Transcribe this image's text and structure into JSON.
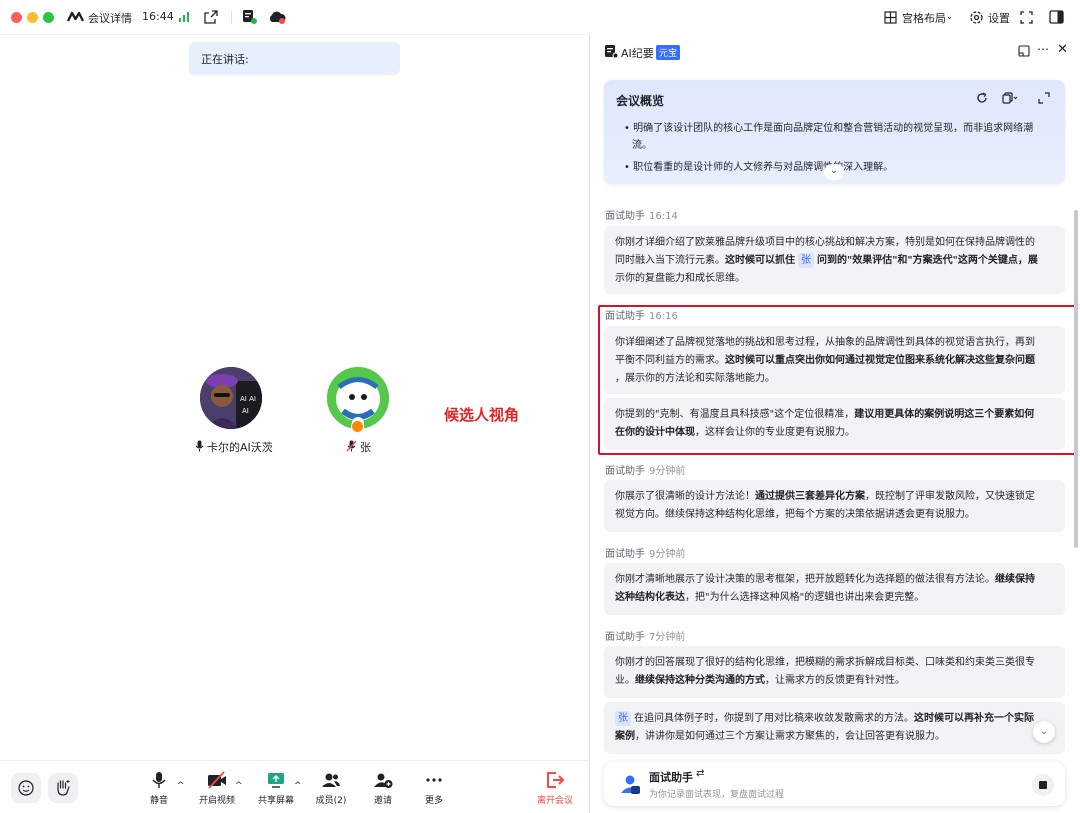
{
  "titlebar": {
    "title": "会议详情",
    "time": "16:44",
    "layout_label": "宫格布局",
    "settings_label": "设置",
    "colors": {
      "red": "#ff5f57",
      "yellow": "#febc2e",
      "green": "#28c840"
    }
  },
  "meeting": {
    "speaking_label": "正在讲话:",
    "participants": [
      {
        "name": "卡尔的AI沃茨",
        "mic": "mic-on-icon"
      },
      {
        "name": "张",
        "mic": "mic-off-icon"
      }
    ],
    "annotation": "候选人视角"
  },
  "toolbar": {
    "mute": "静音",
    "video": "开启视频",
    "share": "共享屏幕",
    "members": "成员(2)",
    "invite": "邀请",
    "more": "更多",
    "leave": "离开会议"
  },
  "panel": {
    "title": "AI纪要",
    "badge": "元宝",
    "overview": {
      "title": "会议概览",
      "bullets": [
        "• 明确了该设计团队的核心工作是面向品牌定位和整合营销活动的视觉呈现，而非追求网络潮",
        "流。",
        "• 职位看重的是设计师的人文修养与对品牌调性的深入理解。"
      ]
    },
    "messages": [
      {
        "sender": "面试助手",
        "time": "16:14",
        "paragraphs": [
          {
            "a": "你刚才详细介绍了欧莱雅品牌升级项目中的核心挑战和解决方案，特别是如何在保持品牌调性的",
            "b": "同时融入当下流行元素。",
            "c": "这时候可以抓住",
            "chip": "张",
            "d": "问到的\"效果评估\"和\"方案迭代\"这两个关键点，展",
            "e": "示你的复盘能力和成长思维。"
          }
        ]
      },
      {
        "sender": "面试助手",
        "time": "16:16",
        "paragraphs": [
          {
            "a": "你详细阐述了品牌视觉落地的挑战和思考过程，从抽象的品牌调性到具体的视觉语言执行，再到",
            "b": "平衡不同利益方的需求。",
            "c": "这时候可以重点突出你如何通过视觉定位图来系统化解决这些复杂问题",
            "d": "，展示你的方法论和实际落地能力。"
          },
          {
            "a": "你提到的\"克制、有温度且具科技感\"这个定位很精准，",
            "b": "建议用更具体的案例说明这三个要素如何",
            "c": "在你的设计中体现",
            "d": "，这样会让你的专业度更有说服力。"
          }
        ]
      },
      {
        "sender": "面试助手",
        "time": "9分钟前",
        "paragraphs": [
          {
            "a": "你展示了很清晰的设计方法论！",
            "b": "通过提供三套差异化方案",
            "c": "，既控制了评审发散风险，又快速锁定",
            "d": "视觉方向。继续保持这种结构化思维，把每个方案的决策依据讲透会更有说服力。"
          }
        ]
      },
      {
        "sender": "面试助手",
        "time": "9分钟前",
        "paragraphs": [
          {
            "a": "你刚才清晰地展示了设计决策的思考框架，把开放题转化为选择题的做法很有方法论。",
            "b": "继续保持",
            "c": "这种结构化表达",
            "d": "，把\"为什么选择这种风格\"的逻辑也讲出来会更完整。"
          }
        ]
      },
      {
        "sender": "面试助手",
        "time": "7分钟前",
        "paragraphs": [
          {
            "a": "你刚才的回答展现了很好的结构化思维，把模糊的需求拆解成目标类、口味类和约束类三类很专",
            "b": "业。",
            "c": "继续保持这种分类沟通的方式",
            "d": "，让需求方的反馈更有针对性。"
          },
          {
            "chip": "张",
            "a": "在追问具体例子时，你提到了用对比稿来收敛发散需求的方法。",
            "b": "这时候可以再补充一个实际",
            "c": "案例",
            "d": "，讲讲你是如何通过三个方案让需求方聚焦的，会让回答更有说服力。"
          }
        ]
      }
    ],
    "assistant": {
      "title": "面试助手",
      "subtitle": "为你记录面试表现，复盘面试过程"
    }
  }
}
